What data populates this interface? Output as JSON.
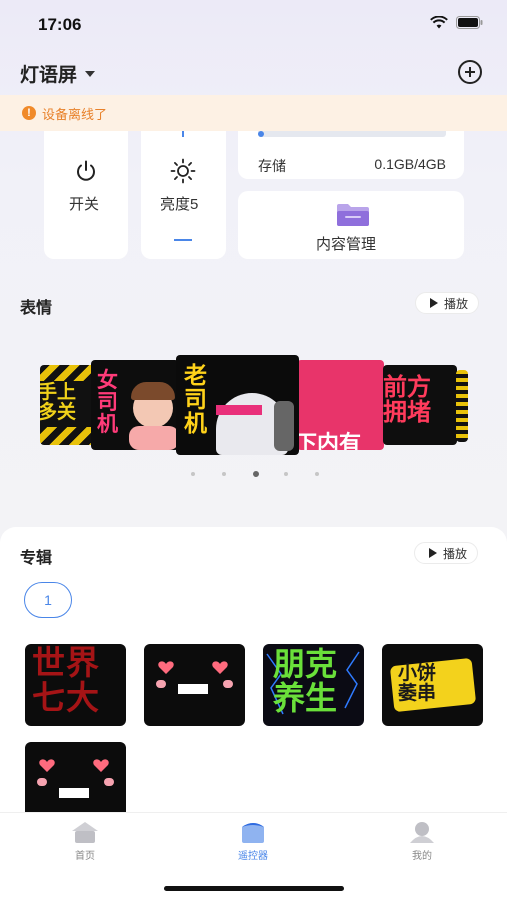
{
  "status_bar": {
    "time": "17:06",
    "wifi_icon": "wifi-icon",
    "battery_icon": "battery-icon"
  },
  "header": {
    "title": "灯语屏",
    "dropdown_icon": "caret-down-icon",
    "add_icon": "plus-circle-icon"
  },
  "banner": {
    "text": "设备离线了",
    "icon": "warning-icon",
    "color": "#e8812a"
  },
  "controls": {
    "power_label": "开关",
    "brightness_label": "亮度5",
    "storage_label": "存储",
    "storage_value": "0.1GB/4GB",
    "storage_fraction": 0.025,
    "content_label": "内容管理"
  },
  "expressions": {
    "title": "表情",
    "play_label": "播放",
    "tiles": [
      {
        "text": "手上\n多关"
      },
      {
        "text": "女\n司\n机"
      },
      {
        "text": "老\n司\n机"
      },
      {
        "text": "下内有"
      },
      {
        "text": "前方\n拥堵"
      }
    ],
    "pages": 5,
    "active_page": 3
  },
  "album": {
    "title": "专辑",
    "play_label": "播放",
    "selected_album": "1",
    "tiles": [
      {
        "text": "世界\n七大"
      },
      {
        "text": ""
      },
      {
        "text": "朋克\n养生"
      },
      {
        "text": "小饼\n萎串"
      },
      {
        "text": ""
      }
    ]
  },
  "tabs": [
    {
      "label": "首页",
      "icon": "home-icon",
      "active": false
    },
    {
      "label": "遥控器",
      "icon": "remote-icon",
      "active": true
    },
    {
      "label": "我的",
      "icon": "profile-icon",
      "active": false
    }
  ],
  "colors": {
    "accent": "#4a86e8",
    "warning": "#f08a2a"
  }
}
